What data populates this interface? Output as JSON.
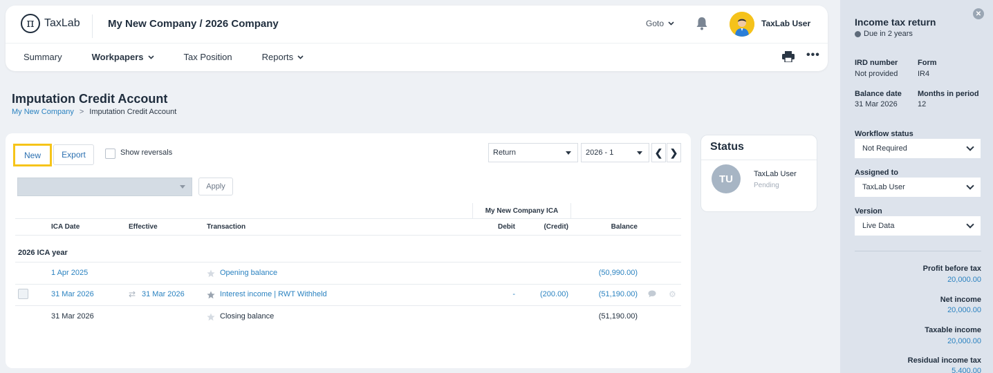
{
  "header": {
    "logo_text": "TaxLab",
    "logo_glyph": "π",
    "company": "My New Company / 2026 Company",
    "goto_label": "Goto",
    "user_name": "TaxLab User",
    "nav": [
      {
        "label": "Summary"
      },
      {
        "label": "Workpapers"
      },
      {
        "label": "Tax Position"
      },
      {
        "label": "Reports"
      }
    ],
    "more_label": "•••"
  },
  "page": {
    "title": "Imputation Credit Account",
    "breadcrumb": {
      "root": "My New Company",
      "separator": ">",
      "current": "Imputation Credit Account"
    }
  },
  "toolbar": {
    "new_label": "New",
    "export_label": "Export",
    "show_reversals_label": "Show reversals",
    "return_select": "Return",
    "year_select": "2026 - 1",
    "prev_glyph": "❮",
    "next_glyph": "❯",
    "apply_label": "Apply"
  },
  "table": {
    "group_header": "My New Company ICA",
    "columns": {
      "ica_date": "ICA Date",
      "effective": "Effective",
      "transaction": "Transaction",
      "debit": "Debit",
      "credit": "(Credit)",
      "balance": "Balance"
    },
    "section_label": "2026 ICA year",
    "rows": [
      {
        "ica_date": "1 Apr 2025",
        "effective": "",
        "transaction": "Opening balance",
        "debit": "",
        "credit": "",
        "balance": "(50,990.00)"
      },
      {
        "ica_date": "31 Mar 2026",
        "effective": "31 Mar 2026",
        "transaction": "Interest income | RWT Withheld",
        "debit": "-",
        "credit": "(200.00)",
        "balance": "(51,190.00)"
      },
      {
        "ica_date": "31 Mar 2026",
        "effective": "",
        "transaction": "Closing balance",
        "debit": "",
        "credit": "",
        "balance": "(51,190.00)"
      }
    ]
  },
  "status": {
    "title": "Status",
    "initials": "TU",
    "user": "TaxLab User",
    "state": "Pending"
  },
  "panel": {
    "title": "Income tax return",
    "due": "Due in 2 years",
    "ird_label": "IRD number",
    "ird_value": "Not provided",
    "form_label": "Form",
    "form_value": "IR4",
    "balance_date_label": "Balance date",
    "balance_date_value": "31 Mar 2026",
    "months_label": "Months in period",
    "months_value": "12",
    "workflow_label": "Workflow status",
    "workflow_value": "Not Required",
    "assigned_label": "Assigned to",
    "assigned_value": "TaxLab User",
    "version_label": "Version",
    "version_value": "Live Data",
    "metrics": [
      {
        "label": "Profit before tax",
        "value": "20,000.00"
      },
      {
        "label": "Net income",
        "value": "20,000.00"
      },
      {
        "label": "Taxable income",
        "value": "20,000.00"
      },
      {
        "label": "Residual income tax",
        "value": "5,400.00"
      }
    ]
  },
  "colors": {
    "accent_blue": "#2a82c0",
    "highlight_yellow": "#f6c419",
    "panel_bg": "#dde3ec"
  }
}
